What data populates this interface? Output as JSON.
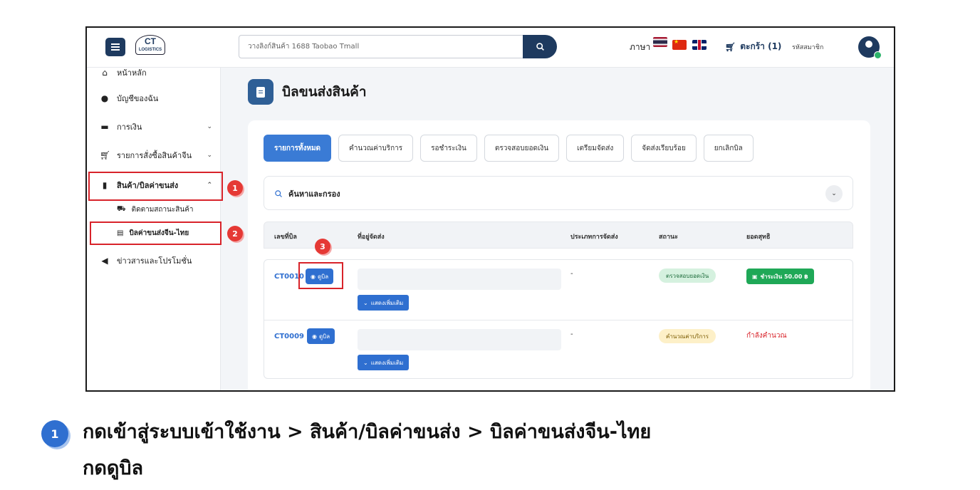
{
  "header": {
    "search_placeholder": "วางลิงก์สินค้า 1688 Taobao Tmall",
    "language_label": "ภาษา",
    "cart_label": "ตะกร้า (1)",
    "member_label": "รหัสสมาชิก",
    "logo_big": "CT",
    "logo_small": "LOGISTICS"
  },
  "sidebar": {
    "items": [
      {
        "label": "หน้าหลัก",
        "icon": "home-icon"
      },
      {
        "label": "บัญชีของฉัน",
        "icon": "user-icon"
      },
      {
        "label": "การเงิน",
        "icon": "wallet-icon"
      },
      {
        "label": "รายการสั่งซื้อสินค้าจีน",
        "icon": "cart-icon"
      },
      {
        "label": "สินค้า/บิลค่าขนส่ง",
        "icon": "invoice-icon"
      },
      {
        "label": "ข่าวสารและโปรโมชั่น",
        "icon": "megaphone-icon"
      }
    ],
    "sub_items": [
      {
        "label": "ติดตามสถานะสินค้า",
        "icon": "truck-icon"
      },
      {
        "label": "บิลค่าขนส่งจีน-ไทย",
        "icon": "document-icon"
      }
    ]
  },
  "main": {
    "page_title": "บิลขนส่งสินค้า",
    "tabs": [
      {
        "label": "รายการทั้งหมด"
      },
      {
        "label": "คำนวณค่าบริการ"
      },
      {
        "label": "รอชำระเงิน"
      },
      {
        "label": "ตรวจสอบยอดเงิน"
      },
      {
        "label": "เตรียมจัดส่ง"
      },
      {
        "label": "จัดส่งเรียบร้อย"
      },
      {
        "label": "ยกเลิกบิล"
      }
    ],
    "filter_label": "ค้นหาและกรอง",
    "columns": [
      "เลขที่บิล",
      "ที่อยู่จัดส่ง",
      "ประเภทการจัดส่ง",
      "สถานะ",
      "ยอดสุทธิ"
    ],
    "rows": [
      {
        "bill_no": "CT0010",
        "view_label": "ดูบิล",
        "more_label": "แสดงเพิ่มเติม",
        "shipping_type": "-",
        "status": "ตรวจสอบยอดเงิน",
        "total": "ชำระเงิน 50.00 ฿"
      },
      {
        "bill_no": "CT0009",
        "view_label": "ดูบิล",
        "more_label": "แสดงเพิ่มเติม",
        "shipping_type": "-",
        "status": "คำนวณค่าบริการ",
        "total": "กำลังคำนวณ"
      }
    ]
  },
  "markers": [
    "1",
    "2",
    "3"
  ],
  "instruction": {
    "step": "1",
    "line1": "กดเข้าสู่ระบบเข้าใช้งาน > สินค้า/บิลค่าขนส่ง > บิลค่าขนส่งจีน-ไทย",
    "line2": "กดดูบิล"
  },
  "colors": {
    "primary": "#1e3a5f",
    "accent": "#2f6fd0",
    "highlight": "#d8232a",
    "success": "#1fa857"
  }
}
